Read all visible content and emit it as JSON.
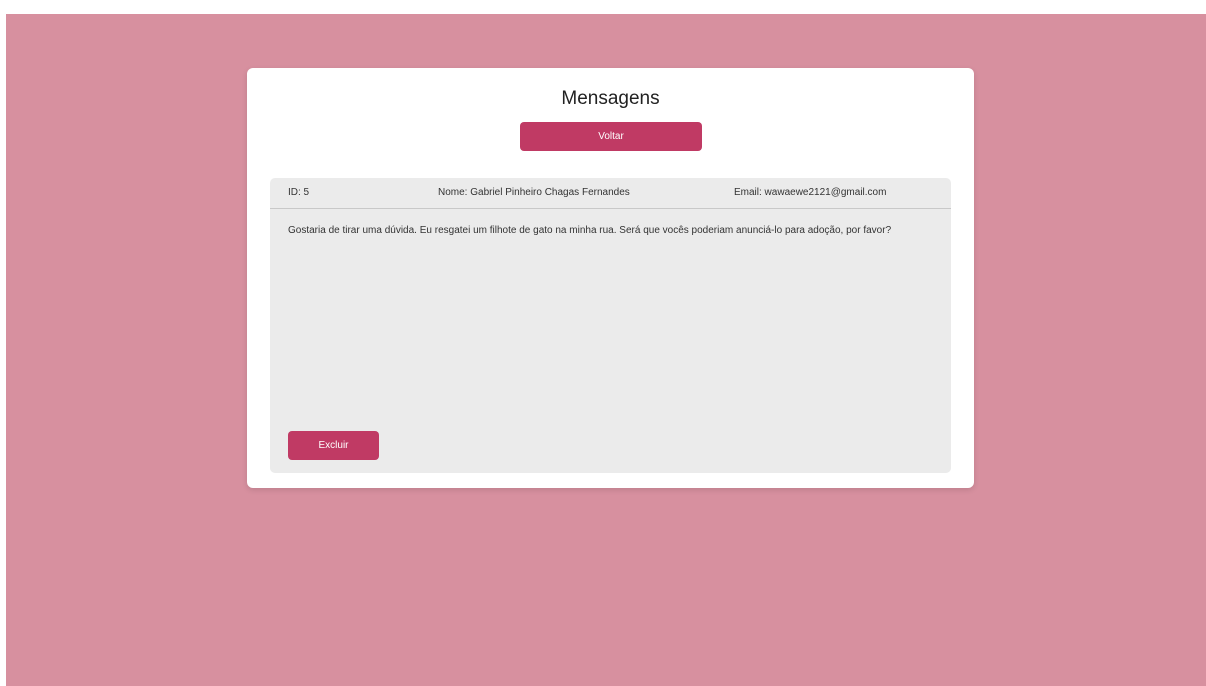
{
  "page": {
    "title": "Mensagens",
    "back_button_label": "Voltar"
  },
  "message": {
    "id_label": "ID: 5",
    "name_label": "Nome: Gabriel Pinheiro Chagas Fernandes",
    "email_label": "Email: wawaewe2121@gmail.com",
    "body": "Gostaria de tirar uma dúvida. Eu resgatei um filhote de gato na minha rua. Será que vocês poderiam anunciá-lo para adoção, por favor?",
    "delete_button_label": "Excluir"
  },
  "colors": {
    "background": "#d7909f",
    "card": "#ffffff",
    "panel": "#ebebeb",
    "accent": "#c03a64"
  }
}
